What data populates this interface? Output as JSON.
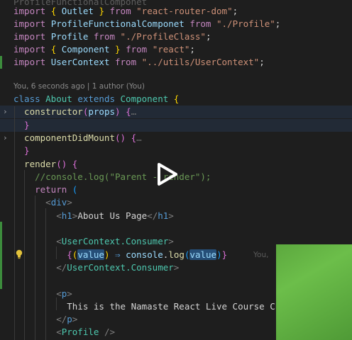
{
  "editor": {
    "top_fragment": "ProfileFunctionalComponet",
    "blame_header": "You, 6 seconds ago | 1 author (You)",
    "inline_blame": "You,",
    "lines": [
      {
        "tokens": [
          [
            "import ",
            "k-import"
          ],
          [
            "{ ",
            "brace2"
          ],
          [
            "Outlet ",
            "ident"
          ],
          [
            "} ",
            "brace2"
          ],
          [
            "from ",
            "k-import"
          ],
          [
            "\"react-router-dom\"",
            "str"
          ],
          [
            ";",
            "punc"
          ]
        ]
      },
      {
        "tokens": [
          [
            "import ",
            "k-import"
          ],
          [
            "ProfileFunctionalComponet ",
            "ident"
          ],
          [
            "from ",
            "k-import"
          ],
          [
            "\"./Profile\"",
            "str"
          ],
          [
            ";",
            "punc"
          ]
        ]
      },
      {
        "tokens": [
          [
            "import ",
            "k-import"
          ],
          [
            "Profile ",
            "ident"
          ],
          [
            "from ",
            "k-import"
          ],
          [
            "\"./ProfileClass\"",
            "str"
          ],
          [
            ";",
            "punc"
          ]
        ]
      },
      {
        "tokens": [
          [
            "import ",
            "k-import"
          ],
          [
            "{ ",
            "brace2"
          ],
          [
            "Component ",
            "ident"
          ],
          [
            "} ",
            "brace2"
          ],
          [
            "from ",
            "k-import"
          ],
          [
            "\"react\"",
            "str"
          ],
          [
            ";",
            "punc"
          ]
        ]
      },
      {
        "tokens": [
          [
            "import ",
            "k-import"
          ],
          [
            "UserContext ",
            "ident"
          ],
          [
            "from ",
            "k-import"
          ],
          [
            "\"../utils/UserContext\"",
            "str"
          ],
          [
            ";",
            "punc"
          ]
        ]
      }
    ],
    "class_lines": [
      {
        "tokens": [
          [
            "class ",
            "k-kw"
          ],
          [
            "About ",
            "cls"
          ],
          [
            "extends ",
            "k-kw"
          ],
          [
            "Component ",
            "cls"
          ],
          [
            "{",
            "brace2"
          ]
        ]
      },
      {
        "tokens": [
          [
            "  constructor",
            "fn"
          ],
          [
            "(",
            "brace"
          ],
          [
            "props",
            "ident"
          ],
          [
            ") ",
            "brace"
          ],
          [
            "{",
            "brace"
          ],
          [
            "…",
            "fold-dots"
          ]
        ]
      },
      {
        "tokens": [
          [
            "  }",
            "brace"
          ]
        ]
      },
      {
        "tokens": [
          [
            "  componentDidMount",
            "fn"
          ],
          [
            "() ",
            "brace"
          ],
          [
            "{",
            "brace"
          ],
          [
            "…",
            "fold-dots"
          ]
        ]
      },
      {
        "tokens": [
          [
            "  }",
            "brace"
          ]
        ]
      },
      {
        "tokens": [
          [
            "  render",
            "fn"
          ],
          [
            "() ",
            "brace"
          ],
          [
            "{",
            "brace"
          ]
        ]
      },
      {
        "tokens": [
          [
            "    //console.log(\"Parent - render\");",
            "cmt"
          ]
        ]
      },
      {
        "tokens": [
          [
            "    return ",
            "k-ctrl"
          ],
          [
            "(",
            "brace3"
          ]
        ]
      },
      {
        "tokens": [
          [
            "      <",
            "tagb"
          ],
          [
            "div",
            "tag"
          ],
          [
            ">",
            "tagb"
          ]
        ]
      },
      {
        "tokens": [
          [
            "        <",
            "tagb"
          ],
          [
            "h1",
            "tag"
          ],
          [
            ">",
            "tagb"
          ],
          [
            "About Us Page",
            "plain"
          ],
          [
            "</",
            "tagb"
          ],
          [
            "h1",
            "tag"
          ],
          [
            ">",
            "tagb"
          ]
        ]
      },
      {
        "tokens": [
          [
            "",
            "plain"
          ]
        ]
      },
      {
        "tokens": [
          [
            "        <",
            "tagb"
          ],
          [
            "UserContext.Consumer",
            "tagcomp"
          ],
          [
            ">",
            "tagb"
          ]
        ]
      },
      {
        "tokens": [
          [
            "          {",
            "brace"
          ],
          [
            "(",
            "brace2"
          ],
          [
            "value",
            "sel-ident"
          ],
          [
            ") ",
            "brace2"
          ],
          [
            "⇒ ",
            "k-kw"
          ],
          [
            "console",
            "ident"
          ],
          [
            ".",
            "punc"
          ],
          [
            "log",
            "fn"
          ],
          [
            "(",
            "brace3"
          ],
          [
            "value",
            "sel-ident"
          ],
          [
            ")",
            "brace3"
          ],
          [
            "}",
            "brace"
          ]
        ]
      },
      {
        "tokens": [
          [
            "        </",
            "tagb"
          ],
          [
            "UserContext.Consumer",
            "tagcomp"
          ],
          [
            ">",
            "tagb"
          ]
        ]
      },
      {
        "tokens": [
          [
            "",
            "plain"
          ]
        ]
      },
      {
        "tokens": [
          [
            "        <",
            "tagb"
          ],
          [
            "p",
            "tag"
          ],
          [
            ">",
            "tagb"
          ]
        ]
      },
      {
        "tokens": [
          [
            "          This is the Namaste React Live Course Chap",
            "plain"
          ]
        ]
      },
      {
        "tokens": [
          [
            "        </",
            "tagb"
          ],
          [
            "p",
            "tag"
          ],
          [
            ">",
            "tagb"
          ]
        ]
      },
      {
        "tokens": [
          [
            "        <",
            "tagb"
          ],
          [
            "Profile ",
            "tagcomp"
          ],
          [
            "/>",
            "tagb"
          ]
        ]
      }
    ]
  },
  "video": {
    "play_icon": "play-icon"
  },
  "colors": {
    "background": "#1e1e1e",
    "modified_gutter": "#3c8c3c",
    "highlight_line": "#222a36"
  }
}
